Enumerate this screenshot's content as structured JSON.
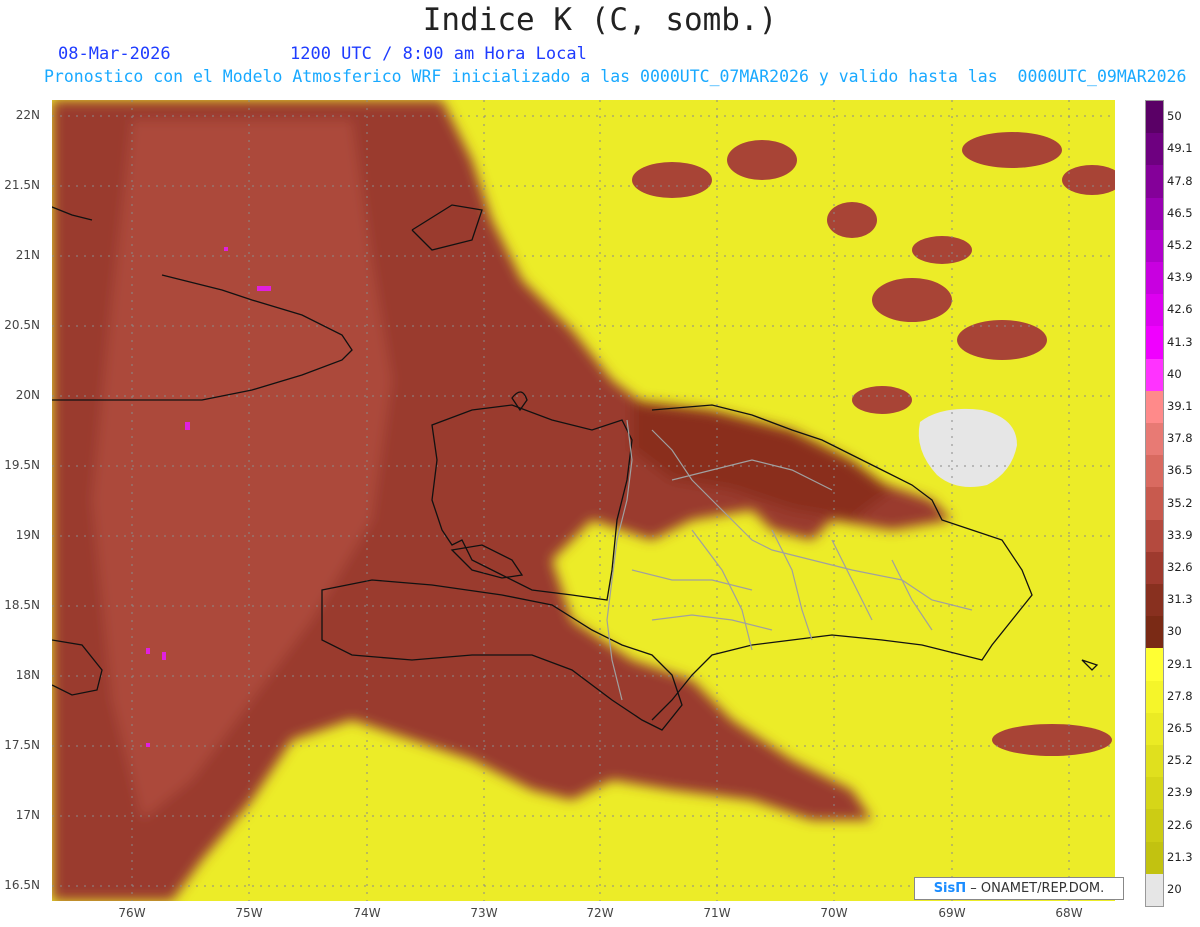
{
  "title": "Indice K (C, somb.)",
  "date": "08-Mar-2026",
  "time": "1200 UTC / 8:00 am Hora Local",
  "forecast_line": "Pronostico con el Modelo Atmosferico WRF inicializado a las 0000UTC_07MAR2026 y valido hasta las  0000UTC_09MAR2026",
  "credit": {
    "logo": "SisΠ",
    "text": "– ONAMET/REP.DOM."
  },
  "lat_labels": [
    "22N",
    "21.5N",
    "21N",
    "20.5N",
    "20N",
    "19.5N",
    "19N",
    "18.5N",
    "18N",
    "17.5N",
    "17N",
    "16.5N"
  ],
  "lon_labels": [
    "76W",
    "75W",
    "74W",
    "73W",
    "72W",
    "71W",
    "70W",
    "69W",
    "68W"
  ],
  "colorbar": {
    "labels": [
      "50",
      "49.1",
      "47.8",
      "46.5",
      "45.2",
      "43.9",
      "42.6",
      "41.3",
      "40",
      "39.1",
      "37.8",
      "36.5",
      "35.2",
      "33.9",
      "32.6",
      "31.3",
      "30",
      "29.1",
      "27.8",
      "26.5",
      "25.2",
      "23.9",
      "22.6",
      "21.3",
      "20"
    ],
    "colors": [
      "#5a0066",
      "#6e0080",
      "#840099",
      "#9900b3",
      "#b000cc",
      "#c800e0",
      "#dd00f0",
      "#f000ff",
      "#ff33ff",
      "#ff8a8a",
      "#e87a74",
      "#d96a60",
      "#c85a4e",
      "#b44a3e",
      "#9e3a2e",
      "#88301f",
      "#7a2a15",
      "#ffff33",
      "#f5f52a",
      "#ebeb24",
      "#e0e01e",
      "#d6d618",
      "#cccc14",
      "#c2c210",
      "#e6e6e6"
    ]
  }
}
